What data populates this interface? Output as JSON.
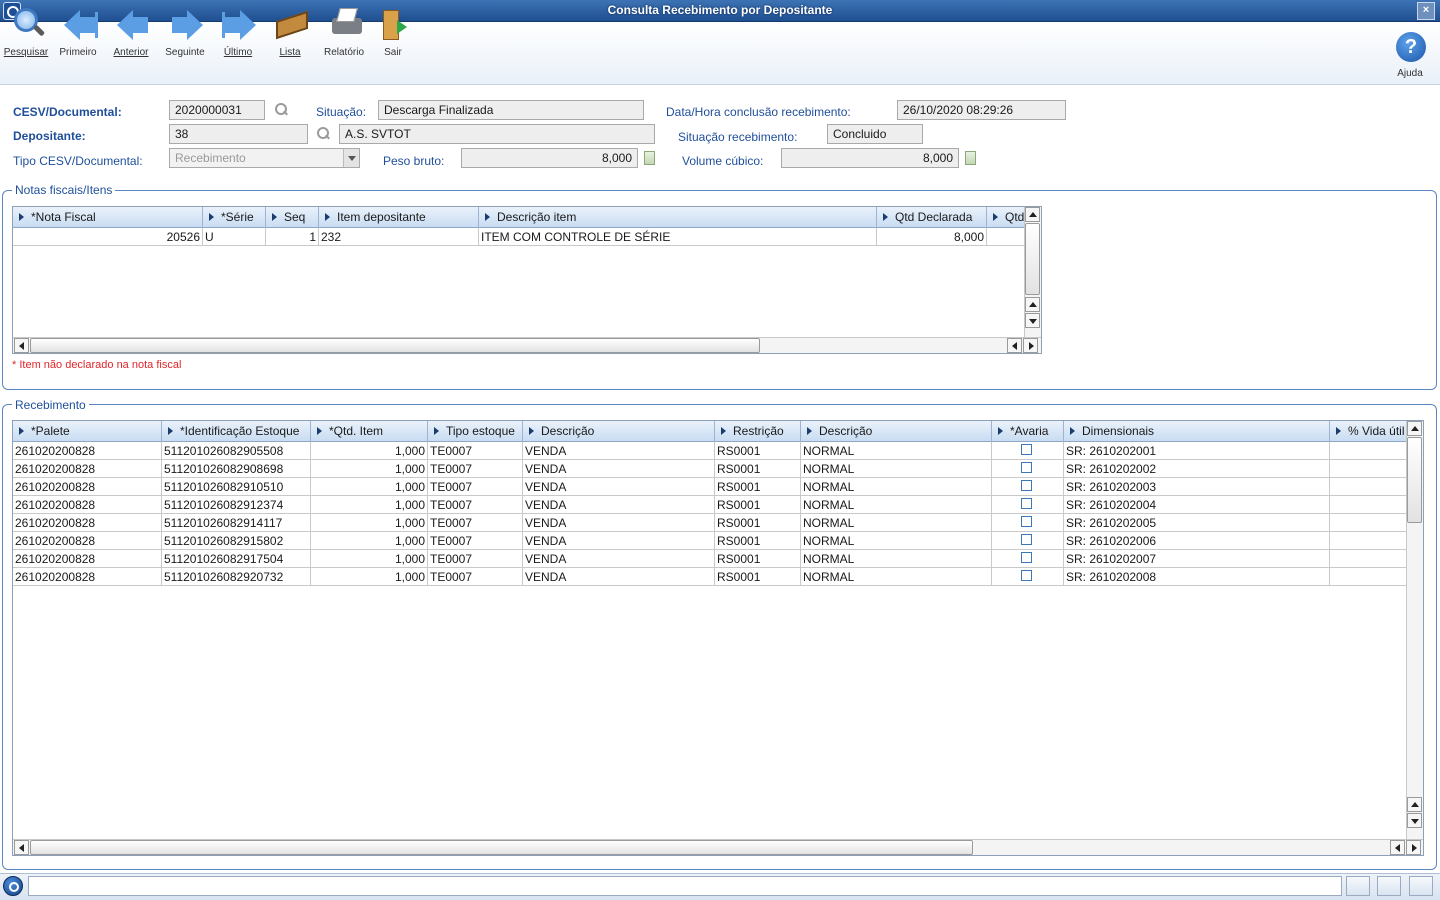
{
  "window": {
    "title": "Consulta Recebimento por Depositante"
  },
  "toolbar": {
    "buttons": [
      {
        "label": "Pesquisar",
        "icon": "search-icon"
      },
      {
        "label": "Primeiro",
        "icon": "first-arrow-icon"
      },
      {
        "label": "Anterior",
        "icon": "previous-arrow-icon"
      },
      {
        "label": "Seguinte",
        "icon": "next-arrow-icon"
      },
      {
        "label": "Último",
        "icon": "last-arrow-icon"
      },
      {
        "label": "Lista",
        "icon": "book-icon"
      },
      {
        "label": "Relatório",
        "icon": "printer-icon"
      },
      {
        "label": "Sair",
        "icon": "exit-door-icon"
      }
    ],
    "help_label": "Ajuda",
    "help_glyph": "?"
  },
  "form": {
    "cesv_label": "CESV/Documental:",
    "cesv_value": "2020000031",
    "situacao_label": "Situação:",
    "situacao_value": "Descarga Finalizada",
    "datahora_label": "Data/Hora conclusão recebimento:",
    "datahora_value": "26/10/2020 08:29:26",
    "depositante_label": "Depositante:",
    "depositante_code": "38",
    "depositante_name": "A.S. SVTOT",
    "sit_receb_label": "Situação recebimento:",
    "sit_receb_value": "Concluido",
    "tipo_label": "Tipo CESV/Documental:",
    "tipo_value": "Recebimento",
    "peso_label": "Peso bruto:",
    "peso_value": "8,000",
    "volume_label": "Volume cúbico:",
    "volume_value": "8,000"
  },
  "notas": {
    "legend": "Notas fiscais/Itens",
    "columns": [
      "*Nota Fiscal",
      "*Série",
      "Seq",
      "Item depositante",
      "Descrição item",
      "Qtd Declarada",
      "Qtd"
    ],
    "rows": [
      {
        "nota": "20526",
        "serie": "U",
        "seq": "1",
        "item": "232",
        "descricao": "ITEM COM CONTROLE DE SÉRIE",
        "qtd_declarada": "8,000",
        "qtd": ""
      }
    ],
    "note": "* Item não declarado na nota fiscal"
  },
  "recebimento": {
    "legend": "Recebimento",
    "columns": [
      "*Palete",
      "*Identificação Estoque",
      "*Qtd. Item",
      "Tipo estoque",
      "Descrição",
      "Restrição",
      "Descrição",
      "*Avaria",
      "Dimensionais",
      "% Vida útil"
    ],
    "rows": [
      {
        "palete": "261020200828",
        "ident": "511201026082905508",
        "qtd": "1,000",
        "tipo": "TE0007",
        "desc": "VENDA",
        "restr": "RS0001",
        "desc2": "NORMAL",
        "dim": "SR: 2610202001",
        "vida": ""
      },
      {
        "palete": "261020200828",
        "ident": "511201026082908698",
        "qtd": "1,000",
        "tipo": "TE0007",
        "desc": "VENDA",
        "restr": "RS0001",
        "desc2": "NORMAL",
        "dim": "SR: 2610202002",
        "vida": ""
      },
      {
        "palete": "261020200828",
        "ident": "511201026082910510",
        "qtd": "1,000",
        "tipo": "TE0007",
        "desc": "VENDA",
        "restr": "RS0001",
        "desc2": "NORMAL",
        "dim": "SR: 2610202003",
        "vida": ""
      },
      {
        "palete": "261020200828",
        "ident": "511201026082912374",
        "qtd": "1,000",
        "tipo": "TE0007",
        "desc": "VENDA",
        "restr": "RS0001",
        "desc2": "NORMAL",
        "dim": "SR: 2610202004",
        "vida": ""
      },
      {
        "palete": "261020200828",
        "ident": "511201026082914117",
        "qtd": "1,000",
        "tipo": "TE0007",
        "desc": "VENDA",
        "restr": "RS0001",
        "desc2": "NORMAL",
        "dim": "SR: 2610202005",
        "vida": ""
      },
      {
        "palete": "261020200828",
        "ident": "511201026082915802",
        "qtd": "1,000",
        "tipo": "TE0007",
        "desc": "VENDA",
        "restr": "RS0001",
        "desc2": "NORMAL",
        "dim": "SR: 2610202006",
        "vida": ""
      },
      {
        "palete": "261020200828",
        "ident": "511201026082917504",
        "qtd": "1,000",
        "tipo": "TE0007",
        "desc": "VENDA",
        "restr": "RS0001",
        "desc2": "NORMAL",
        "dim": "SR: 2610202007",
        "vida": ""
      },
      {
        "palete": "261020200828",
        "ident": "511201026082920732",
        "qtd": "1,000",
        "tipo": "TE0007",
        "desc": "VENDA",
        "restr": "RS0001",
        "desc2": "NORMAL",
        "dim": "SR: 2610202008",
        "vida": ""
      }
    ]
  },
  "statusbar": {
    "text": ""
  }
}
